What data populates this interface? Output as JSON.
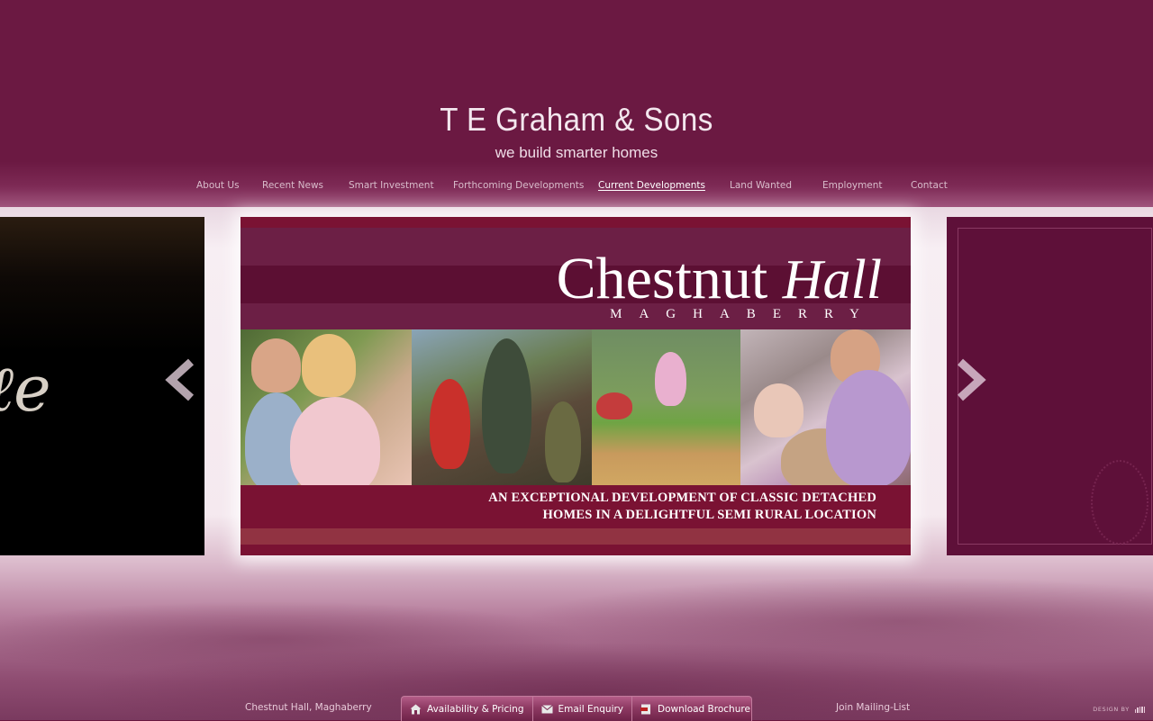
{
  "brand": {
    "name": "T E Graham & Sons",
    "tagline": "we build smarter homes"
  },
  "nav": {
    "items": [
      {
        "label": "About Us"
      },
      {
        "label": "Recent News"
      },
      {
        "label": "Smart Investment"
      },
      {
        "label": "Forthcoming Developments"
      },
      {
        "label": "Current Developments",
        "active": true
      },
      {
        "label": "Land Wanted"
      },
      {
        "label": "Employment"
      },
      {
        "label": "Contact"
      }
    ]
  },
  "slider": {
    "current": {
      "title_main": "Chestnut ",
      "title_italic": "Hall",
      "location": "MAGHABERRY",
      "tagline_line1": "AN EXCEPTIONAL DEVELOPMENT OF CLASSIC DETACHED",
      "tagline_line2": "HOMES IN A DELIGHTFUL SEMI RURAL LOCATION"
    },
    "prev_icon": "chevron-left-icon",
    "next_icon": "chevron-right-icon"
  },
  "footer": {
    "development_name": "Chestnut Hall, Maghaberry",
    "buttons": {
      "availability": "Availability & Pricing",
      "email": "Email Enquiry",
      "brochure": "Download Brochure"
    },
    "mailing_list": "Join Mailing-List",
    "credit": "DESIGN BY"
  },
  "colors": {
    "background": "#6a1940",
    "slide_band": "#7a1233",
    "accent_light": "#f5e9ef"
  }
}
